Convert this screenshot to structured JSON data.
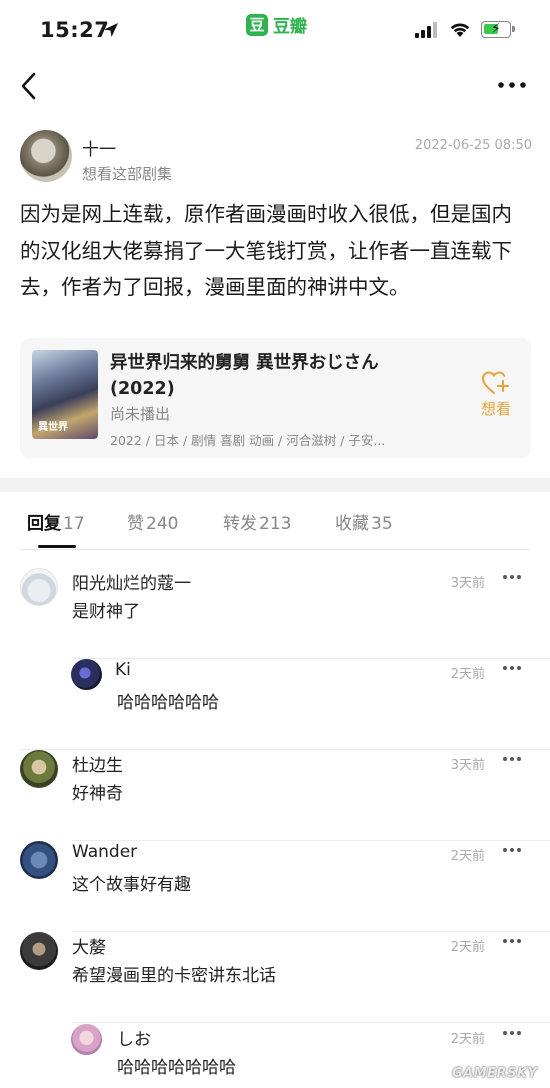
{
  "status_bar": {
    "time": "15:27",
    "app_name": "豆瓣",
    "app_logo_char": "豆"
  },
  "post": {
    "author": "十一",
    "status": "想看这部剧集",
    "timestamp": "2022-06-25 08:50",
    "body": "因为是网上连载，原作者画漫画时收入很低，但是国内的汉化组大佬募捐了一大笔钱打赏，让作者一直连载下去，作者为了回报，漫画里面的神讲中文。"
  },
  "media_card": {
    "title": "异世界归来的舅舅 異世界おじさん (2022)",
    "status": "尚未播出",
    "meta": "2022 / 日本 / 剧情 喜剧 动画 / 河合滋树 / 子安...",
    "want_label": "想看",
    "accent_color": "#e6a23c"
  },
  "tabs": [
    {
      "label": "回复",
      "count": "17",
      "active": true
    },
    {
      "label": "赞",
      "count": "240",
      "active": false
    },
    {
      "label": "转发",
      "count": "213",
      "active": false
    },
    {
      "label": "收藏",
      "count": "35",
      "active": false
    }
  ],
  "comments": [
    {
      "name": "阳光灿烂的蔻一",
      "text": "是财神了",
      "time": "3天前",
      "reply": false,
      "avatar": "avatar-1"
    },
    {
      "name": "Ki",
      "text": "哈哈哈哈哈哈",
      "time": "2天前",
      "reply": true,
      "avatar": "avatar-2"
    },
    {
      "name": "杜边生",
      "text": "好神奇",
      "time": "3天前",
      "reply": false,
      "avatar": "avatar-3"
    },
    {
      "name": "Wander",
      "text": "这个故事好有趣",
      "time": "2天前",
      "reply": false,
      "avatar": "avatar-4"
    },
    {
      "name": "大嫠",
      "text": "希望漫画里的卡密讲东北话",
      "time": "2天前",
      "reply": false,
      "avatar": "avatar-5"
    },
    {
      "name": "しお",
      "text": "哈哈哈哈哈哈哈",
      "time": "2天前",
      "reply": true,
      "avatar": "avatar-6"
    }
  ],
  "watermark": "GAMERSKY"
}
